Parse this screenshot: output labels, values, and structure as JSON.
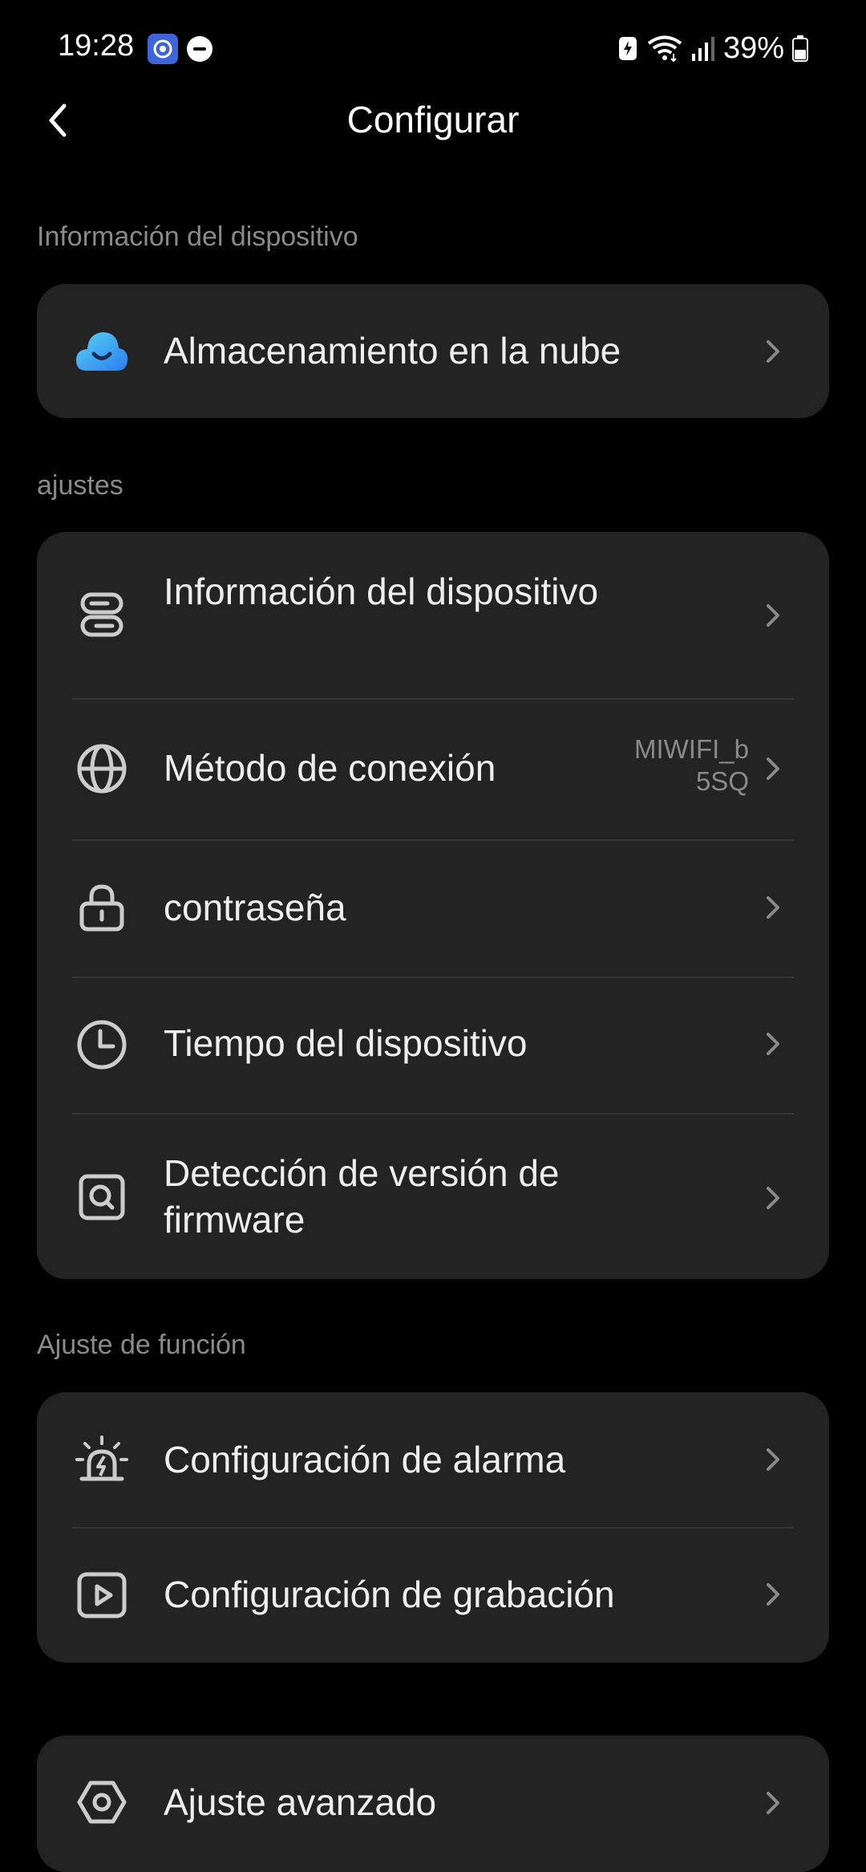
{
  "status_bar": {
    "time": "19:28",
    "battery_percent": "39%",
    "icons": [
      "app-notification-icon",
      "do-not-disturb-icon",
      "battery-saver-icon",
      "wifi-icon",
      "signal-icon",
      "battery-icon"
    ]
  },
  "header": {
    "title": "Configurar",
    "back_icon": "back-arrow-icon"
  },
  "sections": {
    "device_info": {
      "label": "Información del dispositivo",
      "items": [
        {
          "label": "Almacenamiento en la nube",
          "icon": "cloud-icon"
        }
      ]
    },
    "settings": {
      "label": "ajustes",
      "items": [
        {
          "label": "Información del dispositivo",
          "icon": "device-info-icon"
        },
        {
          "label": "Método de conexión",
          "value": "MIWIFI_b 5SQ",
          "icon": "globe-icon"
        },
        {
          "label": "contraseña",
          "icon": "lock-icon"
        },
        {
          "label": "Tiempo del dispositivo",
          "icon": "clock-icon"
        },
        {
          "label": "Detección de versión de firmware",
          "icon": "firmware-search-icon"
        }
      ]
    },
    "function_settings": {
      "label": "Ajuste de función",
      "items": [
        {
          "label": "Configuración de alarma",
          "icon": "alarm-icon"
        },
        {
          "label": "Configuración de grabación",
          "icon": "recording-icon"
        }
      ]
    },
    "advanced": {
      "items": [
        {
          "label": "Ajuste avanzado",
          "icon": "advanced-settings-icon"
        }
      ]
    }
  },
  "colors": {
    "background": "#000000",
    "card": "#232323",
    "primary_text": "#eeeeee",
    "secondary_text": "#8a8a8a",
    "cloud_gradient_start": "#2a9df4",
    "cloud_gradient_end": "#5ad1f5"
  }
}
